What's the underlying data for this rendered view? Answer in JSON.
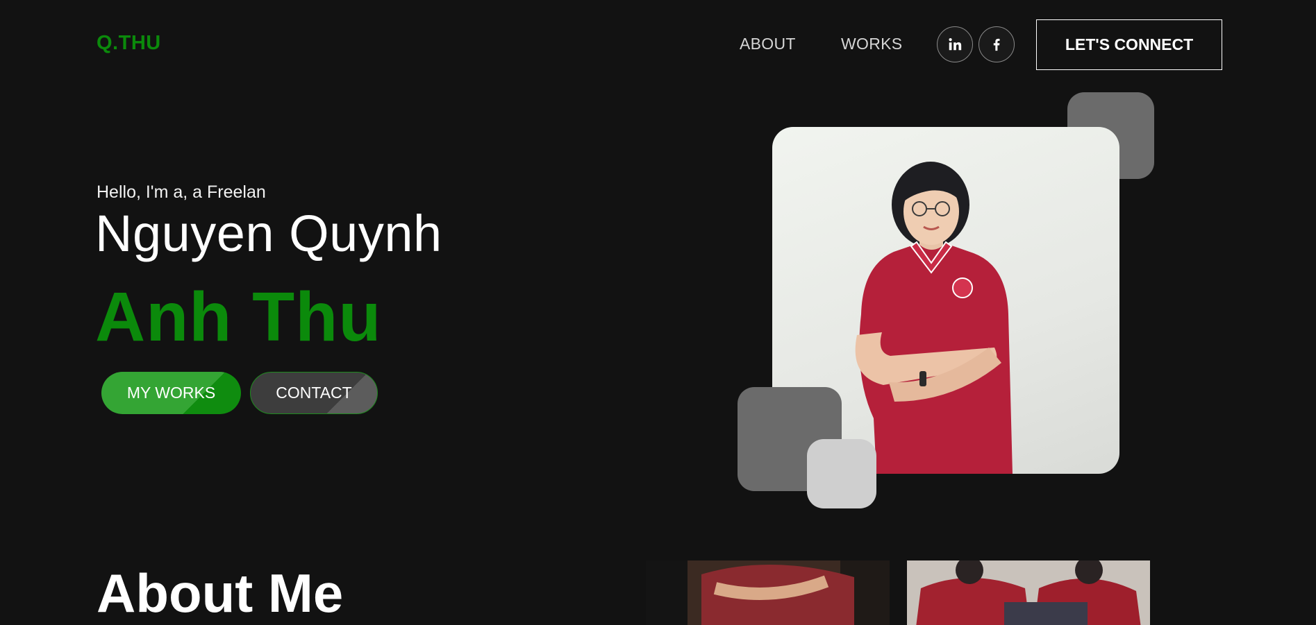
{
  "header": {
    "logo": "Q.THU",
    "nav": [
      {
        "label": "ABOUT"
      },
      {
        "label": "WORKS"
      }
    ],
    "social": [
      {
        "icon": "linkedin-icon"
      },
      {
        "icon": "facebook-icon"
      }
    ],
    "cta_label": "LET'S CONNECT"
  },
  "hero": {
    "greeting": "Hello, I'm a, a Freelan",
    "name_line1": "Nguyen Quynh",
    "name_line2": "Anh Thu",
    "buttons": {
      "works": "MY WORKS",
      "contact": "CONTACT"
    }
  },
  "about": {
    "title": "About Me"
  },
  "colors": {
    "background": "#121212",
    "accent": "#0b8a0b",
    "accent_light": "#34a534",
    "deco_dark": "#6b6b6b",
    "deco_light": "#cfcfcf"
  }
}
